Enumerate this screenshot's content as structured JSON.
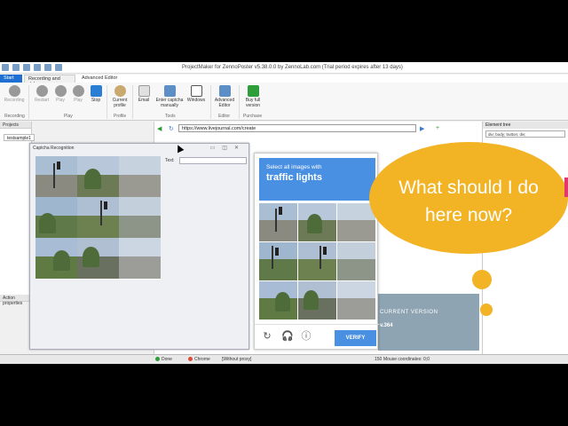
{
  "window": {
    "title": "ProjectMaker for ZennoPoster v5.38.0.0 by ZennoLab.com (Trial period expires after 13 days)"
  },
  "ribbon": {
    "tabs": [
      "Start",
      "Recording and debug",
      "Advanced Editor"
    ],
    "buttons": {
      "recording": "Recording",
      "restart": "Restart",
      "play1": "Play",
      "play2": "Play",
      "stop": "Stop",
      "current_profile": "Current profile",
      "email": "Email",
      "enter_captcha": "Enter captcha manually",
      "windows": "Windows",
      "advanced_editor": "Advanced Editor",
      "buy": "Buy full version"
    },
    "groups": {
      "recording": "Recording",
      "play": "Play",
      "profile": "Profile",
      "tools": "Tools",
      "editor": "Editor",
      "purchase": "Purchase"
    }
  },
  "left_panel": {
    "projects_title": "Projects",
    "project_tab": "testsample1",
    "action_props": "Action properties"
  },
  "captcha_window": {
    "title": "Captcha Recognition",
    "text_label": "Text:",
    "text_value": ""
  },
  "browser": {
    "url": "https://www.livejournal.com/create"
  },
  "right_panel": {
    "title": "Element tree",
    "select_value": "div; body; button; div;"
  },
  "recaptcha": {
    "instruction_line1": "Select all images with",
    "instruction_target": "traffic lights",
    "verify_label": "VERIFY",
    "refresh_icon": "refresh-icon",
    "audio_icon": "headphones-icon",
    "info_icon": "info-icon"
  },
  "lj": {
    "current_version": "CURRENT VERSION",
    "version": "v.364"
  },
  "statusbar": {
    "done": "Done",
    "browser": "Chrome",
    "proxy": "[Without proxy]",
    "zoom": "150",
    "mouse": "Mouse coordinates: 0;0"
  },
  "overlay": {
    "bubble_text": "What should I do here now?",
    "bubble_color": "#f2b325"
  }
}
